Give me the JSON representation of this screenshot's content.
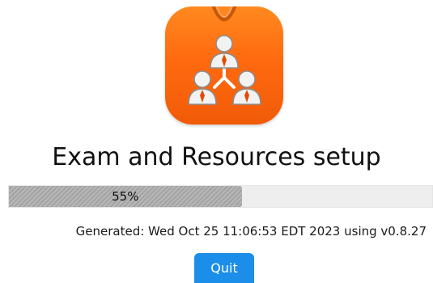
{
  "header": {
    "title": "Exam and Resources setup",
    "logo_icon": "people-network-icon"
  },
  "progress": {
    "label": "55%",
    "percent": 55
  },
  "footer": {
    "generated_text": "Generated: Wed Oct 25 11:06:53 EDT 2023 using v0.8.27"
  },
  "actions": {
    "quit_label": "Quit"
  },
  "colors": {
    "logo_orange": "#ff6a10",
    "progress_fill": "#a8a8a8",
    "progress_track": "#eeeeee",
    "quit_blue": "#1a8ee8"
  }
}
